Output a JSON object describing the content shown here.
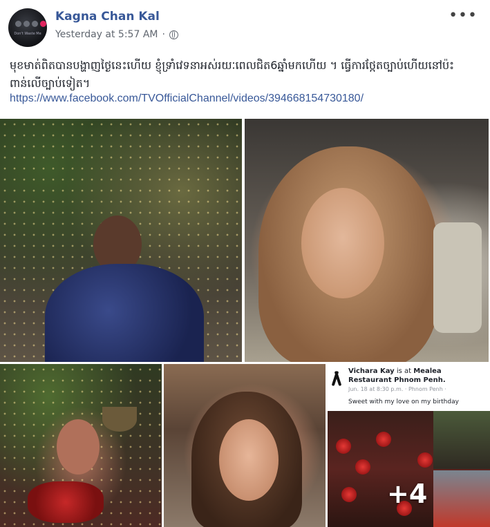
{
  "post": {
    "author": "Kagna Chan Kal",
    "timestamp": "Yesterday at 5:57 AM",
    "separator": "·",
    "more_label": "•••",
    "avatar_caption": "Don't Waste Me",
    "text": "មុខមាត់ពិតបានបង្ហាញថ្ងៃនេះហើយ ខ្ញុំទ្រាំវេទនាអស់រយៈពេលជិត6ឆ្នាំមកហើយ ។ ធ្វើការថ្កែតច្បាប់ហើយនៅប៉ះពាន់លើច្បាប់ទៀត។",
    "link": "https://www.facebook.com/TVOfficialChannel/videos/394668154730180/",
    "more_photos": "+4"
  },
  "shared_screenshot": {
    "title_name": "Vichara Kay",
    "title_at": " is at ",
    "title_place": "Mealea Restaurant Phnom Penh.",
    "sub": "Jun. 18 at 8:30 p.m. · Phnom Penh · ",
    "caption": "Sweet with my love on my birthday"
  },
  "colors": {
    "name": "#385898",
    "link": "#385898",
    "meta": "#616770",
    "text": "#1d2129"
  },
  "icons": [
    "globe-icon",
    "more-icon",
    "mourning-ribbon-icon"
  ]
}
